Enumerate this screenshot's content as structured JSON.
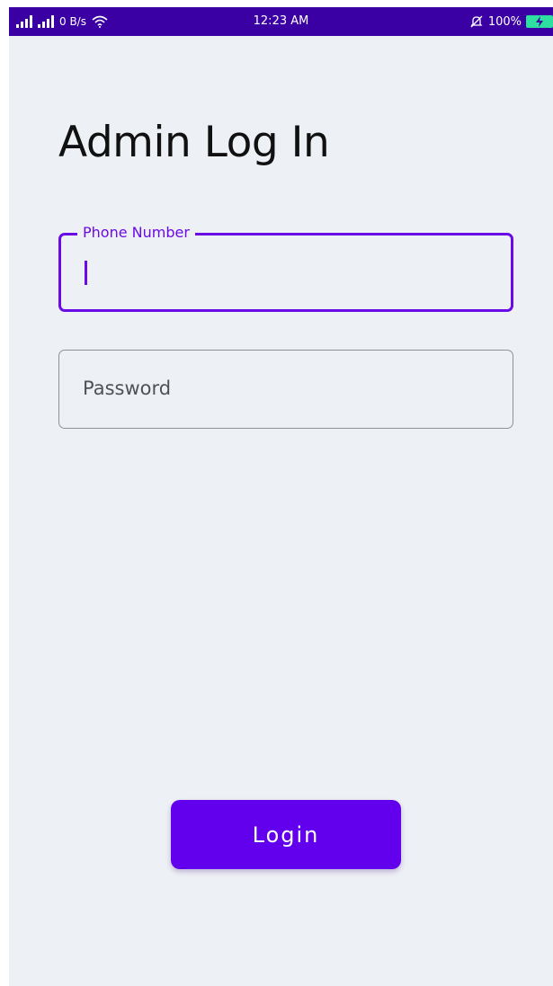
{
  "status_bar": {
    "net_speed": "0 B/s",
    "time": "12:23 AM",
    "battery": "100%",
    "icons": [
      "signal-icon",
      "signal-icon",
      "wifi-icon",
      "bell-muted-icon",
      "battery-charging-icon"
    ],
    "colors": {
      "background": "#3a00a3",
      "battery": "#2ee0a0"
    }
  },
  "page": {
    "title": "Admin Log In"
  },
  "form": {
    "phone": {
      "label": "Phone Number",
      "value": ""
    },
    "password": {
      "placeholder": "Password"
    },
    "login_label": "Login"
  },
  "colors": {
    "accent": "#6200ee",
    "background": "#edf0f4",
    "text": "#111111"
  }
}
